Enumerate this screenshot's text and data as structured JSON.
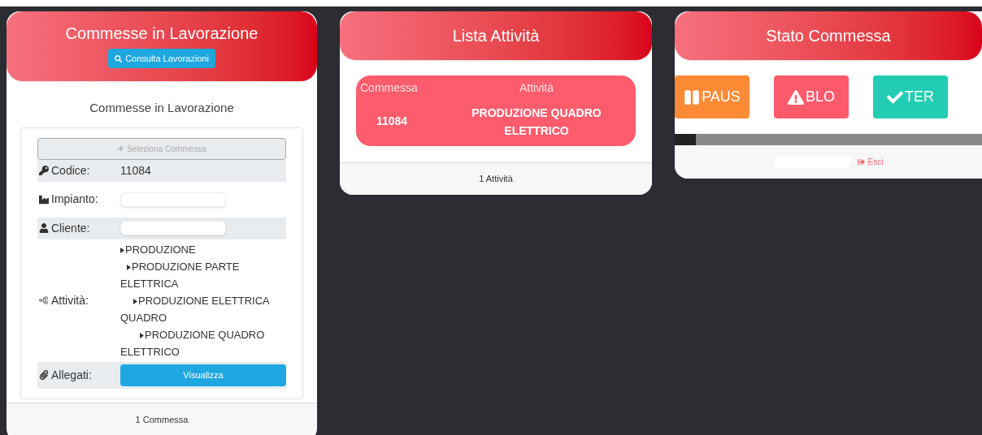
{
  "commesse_panel": {
    "title": "Commesse in Lavorazione",
    "consult_button": "Consulta Lavorazioni",
    "subtitle": "Commesse in Lavorazione",
    "select_button": "Seleziona Commessa",
    "fields": [
      {
        "kind": "text",
        "label": "Codice:",
        "value": "11084"
      },
      {
        "kind": "redacted",
        "label": "Impianto:"
      },
      {
        "kind": "redacted",
        "label": "Cliente:"
      },
      {
        "kind": "tree",
        "label": "Attività:",
        "items": [
          {
            "text": "PRODUZIONE",
            "children": [
              {
                "text": "PRODUZIONE PARTE ELETTRICA",
                "children": [
                  {
                    "text": "PRODUZIONE ELETTRICA QUADRO",
                    "children": [
                      {
                        "text": "PRODUZIONE QUADRO ELETTRICO"
                      }
                    ]
                  }
                ]
              }
            ]
          }
        ]
      },
      {
        "kind": "button",
        "label": "Allegati:",
        "value": "Visualizza"
      }
    ],
    "footer": "1 Commessa"
  },
  "attivita_panel": {
    "title": "Lista Attività",
    "columns": [
      "Commessa",
      "Attività"
    ],
    "rows": [
      [
        "11084",
        "PRODUZIONE QUADRO ELETTRICO"
      ]
    ],
    "footer": "1 Attività"
  },
  "stato_panel": {
    "title": "Stato Commessa",
    "buttons": [
      {
        "kind": "pause",
        "label": "PAUS"
      },
      {
        "kind": "block",
        "label": "BLO"
      },
      {
        "kind": "done",
        "label": "TER"
      }
    ],
    "logout": "Esci"
  }
}
